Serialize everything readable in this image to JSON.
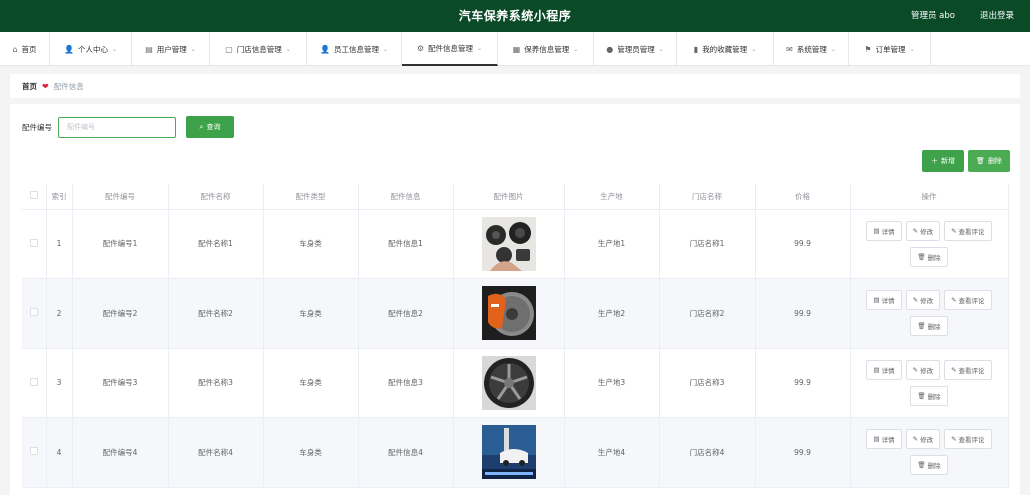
{
  "header": {
    "title": "汽车保养系统小程序",
    "user": "管理员 abo",
    "logout": "退出登录"
  },
  "nav": [
    {
      "label": "首页",
      "icon": "home-icon",
      "glyph": "⌂",
      "chev": false,
      "width": 50
    },
    {
      "label": "个人中心",
      "icon": "person-icon",
      "glyph": "👤",
      "chev": true,
      "width": 82
    },
    {
      "label": "用户管理",
      "icon": "grid-icon",
      "glyph": "▤",
      "chev": true,
      "width": 78
    },
    {
      "label": "门店信息管理",
      "icon": "store-icon",
      "glyph": "▢",
      "chev": true,
      "width": 97
    },
    {
      "label": "员工信息管理",
      "icon": "staff-icon",
      "glyph": "👤",
      "chev": true,
      "width": 95
    },
    {
      "label": "配件信息管理",
      "icon": "parts-icon",
      "glyph": "⚙",
      "chev": true,
      "width": 96,
      "active": true
    },
    {
      "label": "保养信息管理",
      "icon": "maintenance-icon",
      "glyph": "▦",
      "chev": true,
      "width": 96
    },
    {
      "label": "管理员管理",
      "icon": "admin-icon",
      "glyph": "●",
      "chev": true,
      "width": 83
    },
    {
      "label": "我的收藏管理",
      "icon": "favorites-icon",
      "glyph": "▮",
      "chev": true,
      "width": 97
    },
    {
      "label": "系统管理",
      "icon": "system-icon",
      "glyph": "✉",
      "chev": true,
      "width": 75
    },
    {
      "label": "订单管理",
      "icon": "order-icon",
      "glyph": "⚑",
      "chev": true,
      "width": 82
    }
  ],
  "breadcrumb": {
    "home": "首页",
    "current": "配件信息"
  },
  "search": {
    "label": "配件编号",
    "placeholder": "配件编号",
    "button": "查询"
  },
  "toolbar": {
    "add": "新增",
    "delete": "删除"
  },
  "table": {
    "headers": [
      "",
      "索引",
      "配件编号",
      "配件名称",
      "配件类型",
      "配件信息",
      "配件图片",
      "生产地",
      "门店名称",
      "价格",
      "操作"
    ],
    "rows": [
      {
        "index": "1",
        "code": "配件编号1",
        "name": "配件名称1",
        "type": "车身类",
        "info": "配件信息1",
        "image": "speakers",
        "origin": "生产地1",
        "store": "门店名称1",
        "price": "99.9"
      },
      {
        "index": "2",
        "code": "配件编号2",
        "name": "配件名称2",
        "type": "车身类",
        "info": "配件信息2",
        "image": "brake-caliper",
        "origin": "生产地2",
        "store": "门店名称2",
        "price": "99.9"
      },
      {
        "index": "3",
        "code": "配件编号3",
        "name": "配件名称3",
        "type": "车身类",
        "info": "配件信息3",
        "image": "alloy-wheel",
        "origin": "生产地3",
        "store": "门店名称3",
        "price": "99.9"
      },
      {
        "index": "4",
        "code": "配件编号4",
        "name": "配件名称4",
        "type": "车身类",
        "info": "配件信息4",
        "image": "shock-absorber-ad",
        "origin": "生产地4",
        "store": "门店名称4",
        "price": "99.9"
      }
    ],
    "ops": {
      "detail": "详情",
      "edit": "修改",
      "review": "查看评论",
      "delete": "删除"
    }
  },
  "colors": {
    "header_bg": "#0b4a27",
    "accent": "#3da249"
  }
}
